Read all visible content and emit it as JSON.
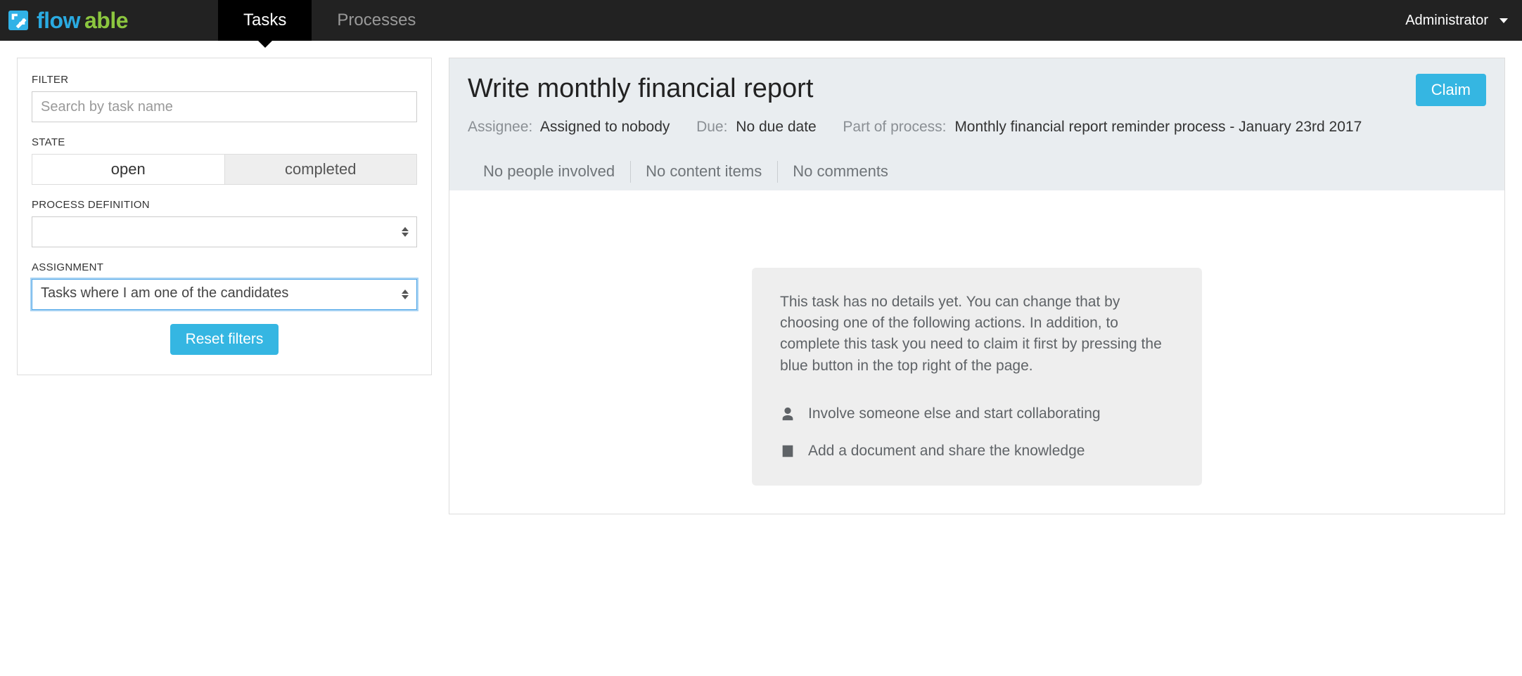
{
  "brand": {
    "logo_primary": "flow",
    "logo_secondary": "able"
  },
  "nav": {
    "tabs": [
      {
        "label": "Tasks",
        "active": true
      },
      {
        "label": "Processes",
        "active": false
      }
    ],
    "user": "Administrator"
  },
  "filter": {
    "heading_filter": "FILTER",
    "search_placeholder": "Search by task name",
    "heading_state": "STATE",
    "state_open": "open",
    "state_completed": "completed",
    "heading_procdef": "PROCESS DEFINITION",
    "procdef_value": "",
    "heading_assignment": "ASSIGNMENT",
    "assignment_value": "Tasks where I am one of the candidates",
    "reset_label": "Reset filters"
  },
  "task": {
    "title": "Write monthly financial report",
    "claim_label": "Claim",
    "meta": {
      "assignee_label": "Assignee:",
      "assignee_value": "Assigned to nobody",
      "due_label": "Due:",
      "due_value": "No due date",
      "part_label": "Part of process:",
      "part_value": "Monthly financial report reminder process - January 23rd 2017"
    },
    "subtabs": {
      "people": "No people involved",
      "content": "No content items",
      "comments": "No comments"
    },
    "hint": {
      "text": "This task has no details yet. You can change that by choosing one of the following actions. In addition, to complete this task you need to claim it first by pressing the blue button in the top right of the page.",
      "action_involve": "Involve someone else and start collaborating",
      "action_document": "Add a document and share the knowledge"
    }
  }
}
